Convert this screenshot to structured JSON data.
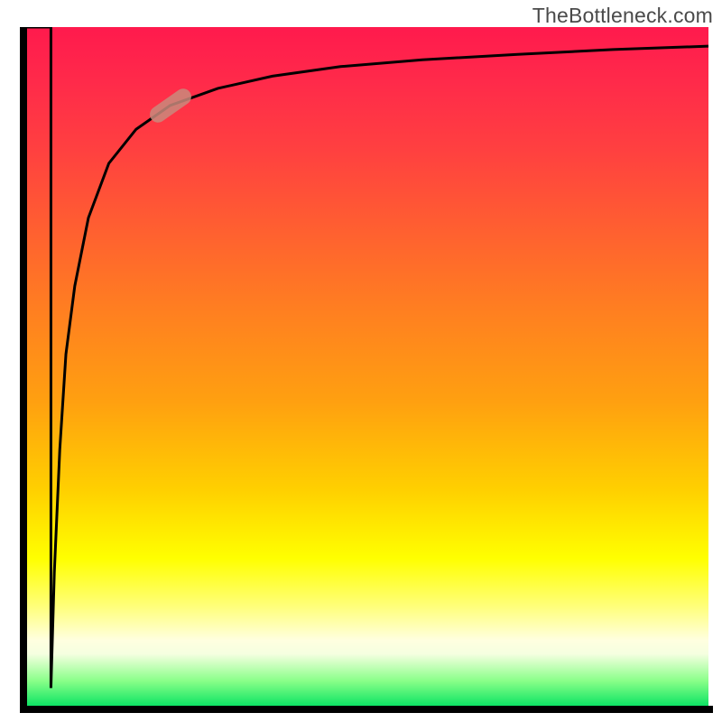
{
  "attribution": "TheBottleneck.com",
  "chart_data": {
    "type": "line",
    "title": "",
    "xlabel": "",
    "ylabel": "",
    "xlim": [
      0,
      100
    ],
    "ylim": [
      0,
      100
    ],
    "grid": false,
    "legend": false,
    "series": [
      {
        "name": "curve",
        "x": [
          0,
          3.5,
          3.5,
          4.0,
          4.8,
          5.7,
          7.0,
          9.0,
          12,
          16,
          21,
          28,
          36,
          46,
          58,
          72,
          86,
          100
        ],
        "y": [
          100,
          100,
          3,
          20,
          38,
          52,
          62,
          72,
          80,
          85,
          88.5,
          91,
          92.8,
          94.2,
          95.2,
          96.0,
          96.7,
          97.2
        ]
      }
    ],
    "highlight_segment": {
      "x": 21,
      "y": 88.5,
      "angle_deg": -35
    },
    "background_gradient": {
      "stops": [
        {
          "pos": 0.0,
          "color": "#ff1a4d"
        },
        {
          "pos": 0.18,
          "color": "#ff4040"
        },
        {
          "pos": 0.42,
          "color": "#ff8020"
        },
        {
          "pos": 0.68,
          "color": "#ffd000"
        },
        {
          "pos": 0.78,
          "color": "#ffff00"
        },
        {
          "pos": 0.9,
          "color": "#ffffe0"
        },
        {
          "pos": 0.96,
          "color": "#88ff88"
        },
        {
          "pos": 1.0,
          "color": "#00e060"
        }
      ]
    }
  }
}
